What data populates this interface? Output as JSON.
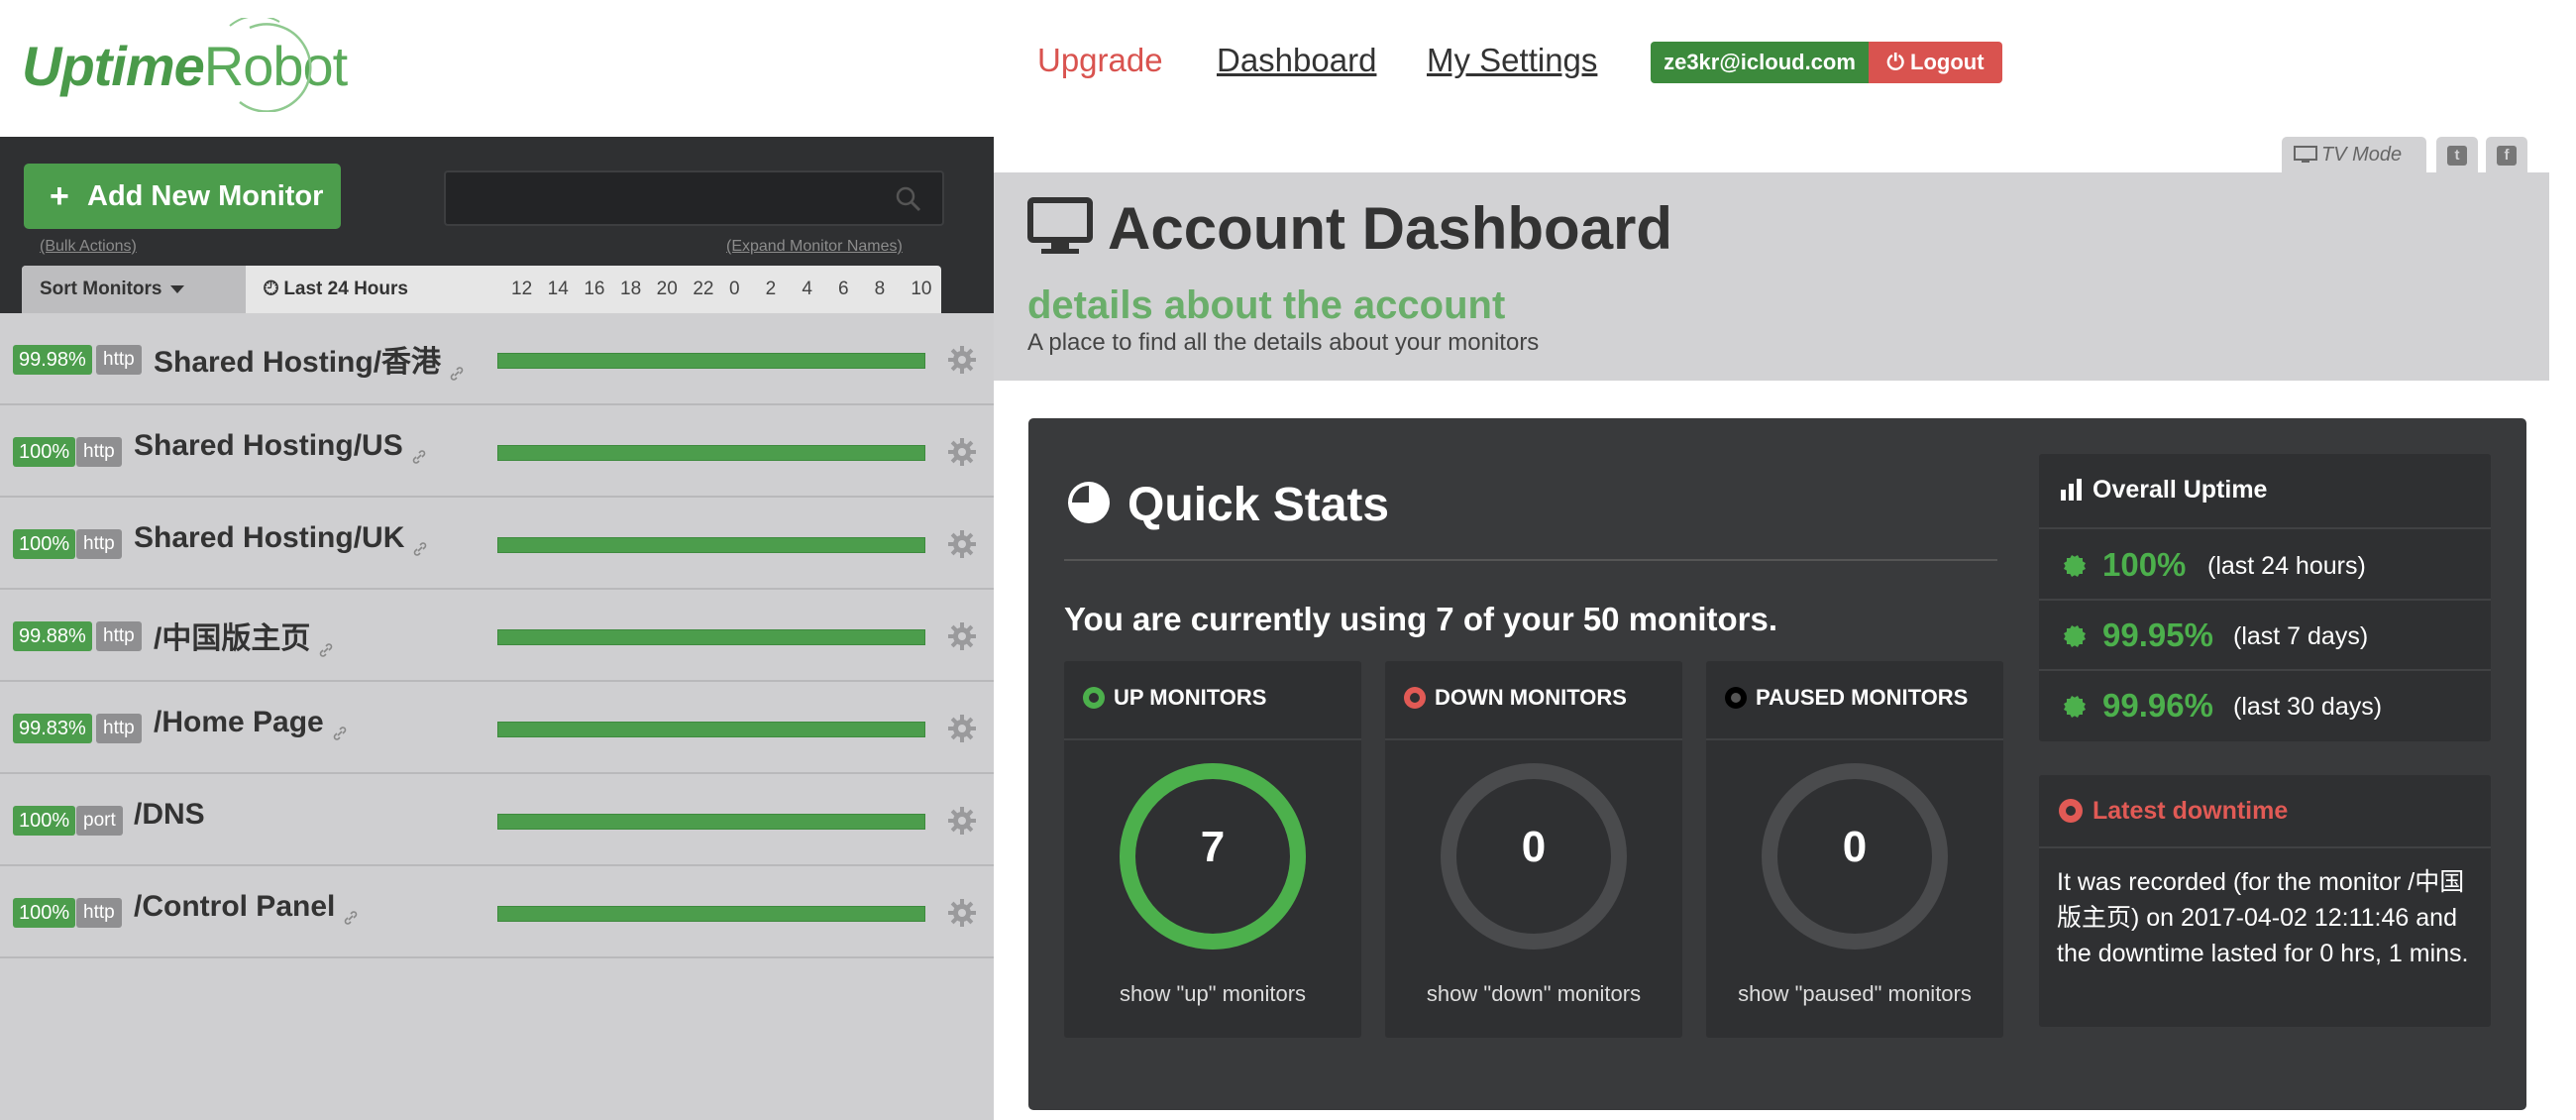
{
  "brand": {
    "logo_bold": "Uptime",
    "logo_light": "Robot",
    "green": "#4c9d4c",
    "red": "#d9534f"
  },
  "topnav": {
    "upgrade": "Upgrade",
    "dashboard": "Dashboard",
    "settings": "My Settings",
    "user_email": "ze3kr@icloud.com",
    "logout": "Logout"
  },
  "sidebar": {
    "add_monitor": "Add New Monitor",
    "search_placeholder": "",
    "bulk_actions": "(Bulk Actions)",
    "expand_names": "(Expand Monitor Names)",
    "sort_monitors": "Sort Monitors",
    "time_range": "Last 24 Hours",
    "hours": [
      "12",
      "14",
      "16",
      "18",
      "20",
      "22",
      "0",
      "2",
      "4",
      "6",
      "8",
      "10"
    ],
    "monitors": [
      {
        "uptime": "99.98%",
        "type": "http",
        "name": "Shared Hosting/香港",
        "has_link": true
      },
      {
        "uptime": "100%",
        "type": "http",
        "name": "Shared Hosting/US",
        "has_link": true
      },
      {
        "uptime": "100%",
        "type": "http",
        "name": "Shared Hosting/UK",
        "has_link": true
      },
      {
        "uptime": "99.88%",
        "type": "http",
        "name": "/中国版主页",
        "has_link": true
      },
      {
        "uptime": "99.83%",
        "type": "http",
        "name": "/Home Page",
        "has_link": true
      },
      {
        "uptime": "100%",
        "type": "port",
        "name": "/DNS",
        "has_link": false
      },
      {
        "uptime": "100%",
        "type": "http",
        "name": "/Control Panel",
        "has_link": true
      }
    ]
  },
  "toolbar": {
    "tv_mode": "TV Mode",
    "twitter_icon": "t",
    "facebook_icon": "f"
  },
  "hero": {
    "title": "Account Dashboard",
    "subtitle": "details about the account",
    "description": "A place to find all the details about your monitors"
  },
  "quick_stats": {
    "title": "Quick Stats",
    "usage": "You are currently using 7 of your 50 monitors.",
    "boxes": [
      {
        "title": "UP MONITORS",
        "count": "7",
        "link": "show \"up\" monitors",
        "color": "#4cb04c",
        "fill_fraction": 1
      },
      {
        "title": "DOWN MONITORS",
        "count": "0",
        "link": "show \"down\" monitors",
        "color": "#e15a55",
        "fill_fraction": 0
      },
      {
        "title": "PAUSED MONITORS",
        "count": "0",
        "link": "show \"paused\" monitors",
        "color": "#000000",
        "fill_fraction": 0
      }
    ]
  },
  "overall_uptime": {
    "title": "Overall Uptime",
    "rows": [
      {
        "value": "100%",
        "period": "(last 24 hours)"
      },
      {
        "value": "99.95%",
        "period": "(last 7 days)"
      },
      {
        "value": "99.96%",
        "period": "(last 30 days)"
      }
    ]
  },
  "latest_downtime": {
    "title": "Latest downtime",
    "text": "It was recorded (for the monitor /中国版主页) on 2017-04-02 12:11:46 and the downtime lasted for 0 hrs, 1 mins."
  }
}
